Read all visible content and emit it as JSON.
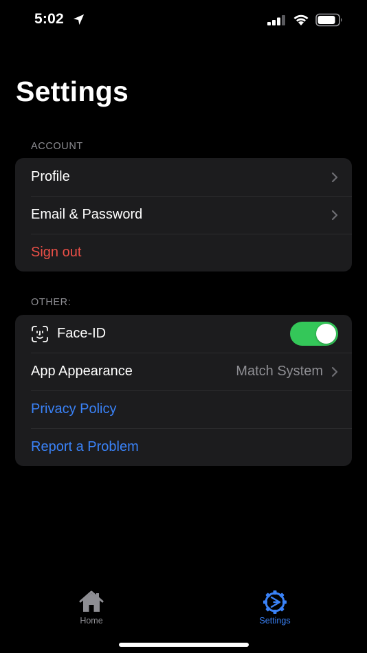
{
  "status_bar": {
    "time": "5:02",
    "icons": [
      "location-arrow-icon",
      "cellular-signal-icon",
      "wifi-icon",
      "battery-icon"
    ]
  },
  "page": {
    "title": "Settings"
  },
  "account": {
    "header": "ACCOUNT",
    "items": [
      {
        "label": "Profile",
        "type": "navigation"
      },
      {
        "label": "Email & Password",
        "type": "navigation"
      },
      {
        "label": "Sign out",
        "type": "destructive"
      }
    ]
  },
  "other": {
    "header": "OTHER:",
    "faceid": {
      "label": "Face-ID",
      "enabled": true,
      "icon": "face-id-icon"
    },
    "appearance": {
      "label": "App Appearance",
      "value": "Match System"
    },
    "privacy": {
      "label": "Privacy Policy"
    },
    "report": {
      "label": "Report a Problem"
    }
  },
  "tab_bar": {
    "tabs": [
      {
        "label": "Home",
        "icon": "house-icon",
        "active": false
      },
      {
        "label": "Settings",
        "icon": "gear-icon",
        "active": true
      }
    ]
  },
  "colors": {
    "background": "#000000",
    "group_background": "#1c1c1e",
    "destructive": "#eb4f47",
    "link": "#3a82f7",
    "toggle_on": "#34c759",
    "secondary_text": "#8e8e93"
  }
}
